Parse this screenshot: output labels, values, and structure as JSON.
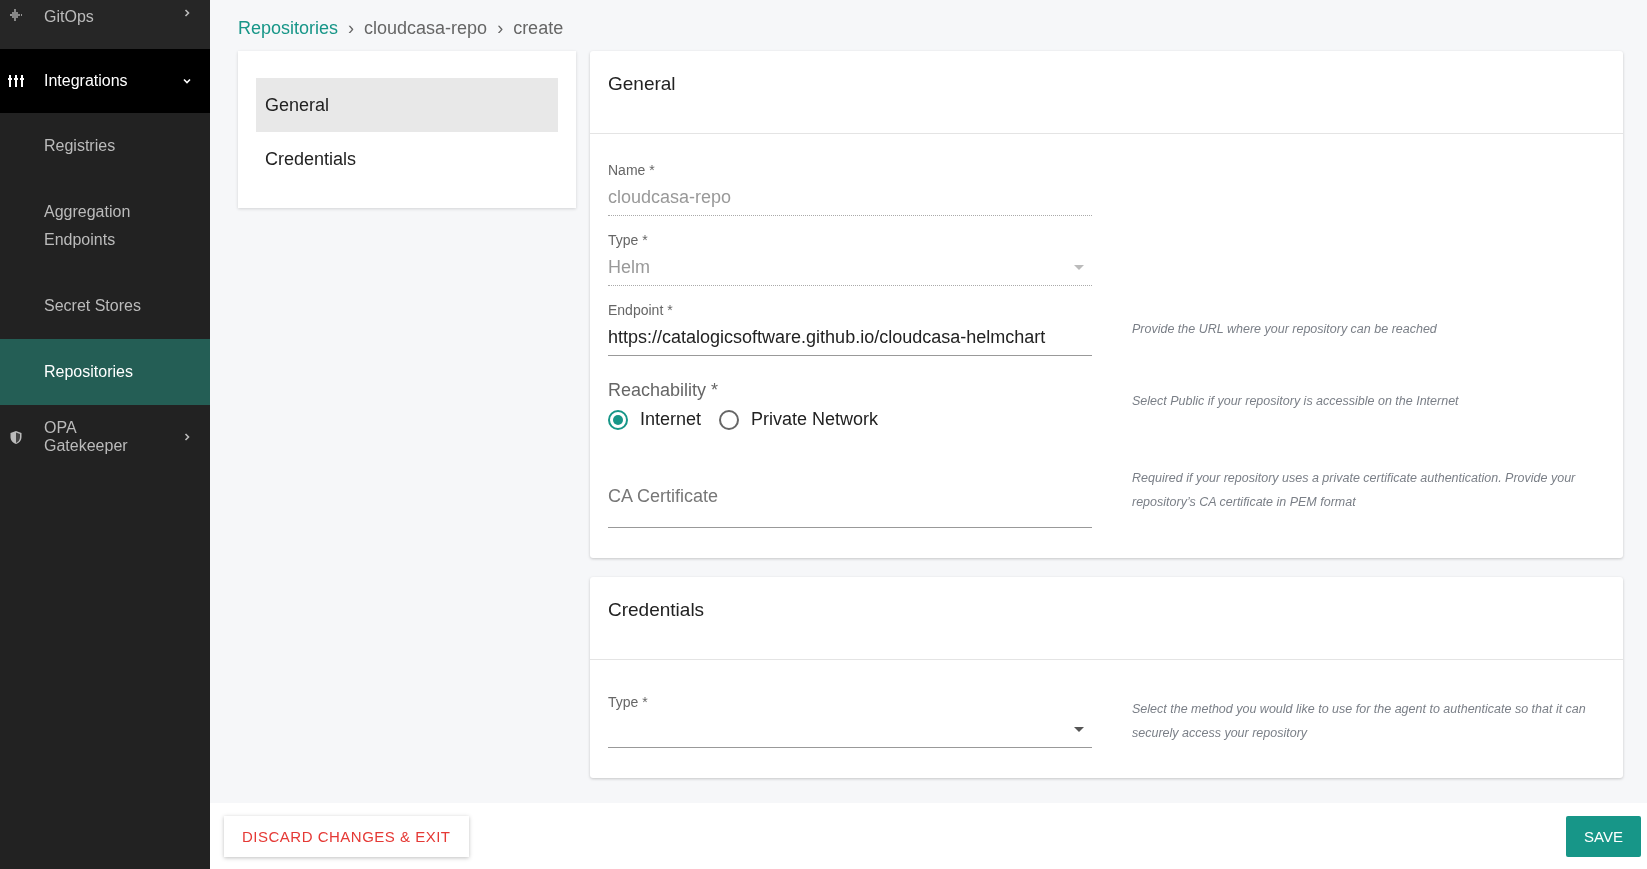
{
  "sidebar": {
    "items": [
      {
        "label": "GitOps",
        "expanded": false,
        "selected": false
      },
      {
        "label": "Integrations",
        "expanded": true,
        "selected": true,
        "children": [
          {
            "label": "Registries",
            "selected": false
          },
          {
            "label": "Aggregation Endpoints",
            "selected": false
          },
          {
            "label": "Secret Stores",
            "selected": false
          },
          {
            "label": "Repositories",
            "selected": true
          }
        ]
      },
      {
        "label": "OPA Gatekeeper",
        "expanded": false,
        "selected": false
      }
    ]
  },
  "breadcrumb": [
    {
      "kind": "link",
      "label": "Repositories"
    },
    {
      "kind": "separator",
      "label": "›"
    },
    {
      "kind": "text",
      "label": "cloudcasa-repo"
    },
    {
      "kind": "separator",
      "label": "›"
    },
    {
      "kind": "text",
      "label": "create"
    }
  ],
  "section_nav": [
    {
      "label": "General",
      "selected": true
    },
    {
      "label": "Credentials",
      "selected": false
    }
  ],
  "sections": [
    {
      "title": "General",
      "fields": [
        {
          "kind": "text",
          "label": "Name *",
          "value": "cloudcasa-repo",
          "disabled": true
        },
        {
          "kind": "select",
          "label": "Type *",
          "value": "Helm",
          "disabled": true
        },
        {
          "kind": "text",
          "label": "Endpoint *",
          "value": "https://catalogicsoftware.github.io/cloudcasa-helmchart",
          "disabled": false,
          "help": "Provide the URL where your repository can be reached"
        },
        {
          "kind": "radio",
          "label": "Reachability *",
          "options": [
            {
              "label": "Internet",
              "selected": true
            },
            {
              "label": "Private Network",
              "selected": false
            }
          ],
          "help": "Select Public if your repository is accessible on the Internet"
        },
        {
          "kind": "textarea",
          "placeholder": "CA Certificate",
          "help": "Required if your repository uses a private certificate authentication. Provide your repository’s CA certificate in PEM format"
        }
      ]
    },
    {
      "title": "Credentials",
      "fields": [
        {
          "kind": "select",
          "label": "Type *",
          "disabled": false,
          "help": "Select the method you would like to use for the agent to authenticate so that it can securely access your repository"
        }
      ]
    }
  ],
  "footer": {
    "discard": "DISCARD CHANGES & EXIT",
    "save": "SAVE"
  }
}
